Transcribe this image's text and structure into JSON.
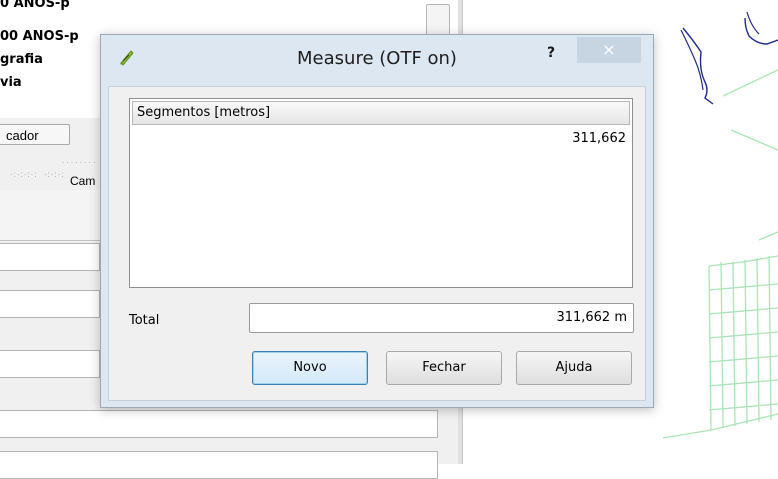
{
  "background_panel": {
    "layer_items": [
      "0 ANOS-p",
      "00 ANOS-p",
      "grafia",
      "via"
    ],
    "tab_label": "cador",
    "partial_label": "Cam"
  },
  "dialog": {
    "title": "Measure (OTF on)",
    "help_label": "?",
    "close_label": "×",
    "segments_header": "Segmentos [metros]",
    "segments": [
      "311,662"
    ],
    "total_label": "Total",
    "total_value": "311,662 m",
    "buttons": {
      "novo": "Novo",
      "fechar": "Fechar",
      "ajuda": "Ajuda"
    }
  },
  "colors": {
    "dialog_frame": "#dde7f1",
    "default_button_border": "#3c7fb1",
    "map_river": "#1f2b8f",
    "map_roads": "#a8e6b4"
  }
}
